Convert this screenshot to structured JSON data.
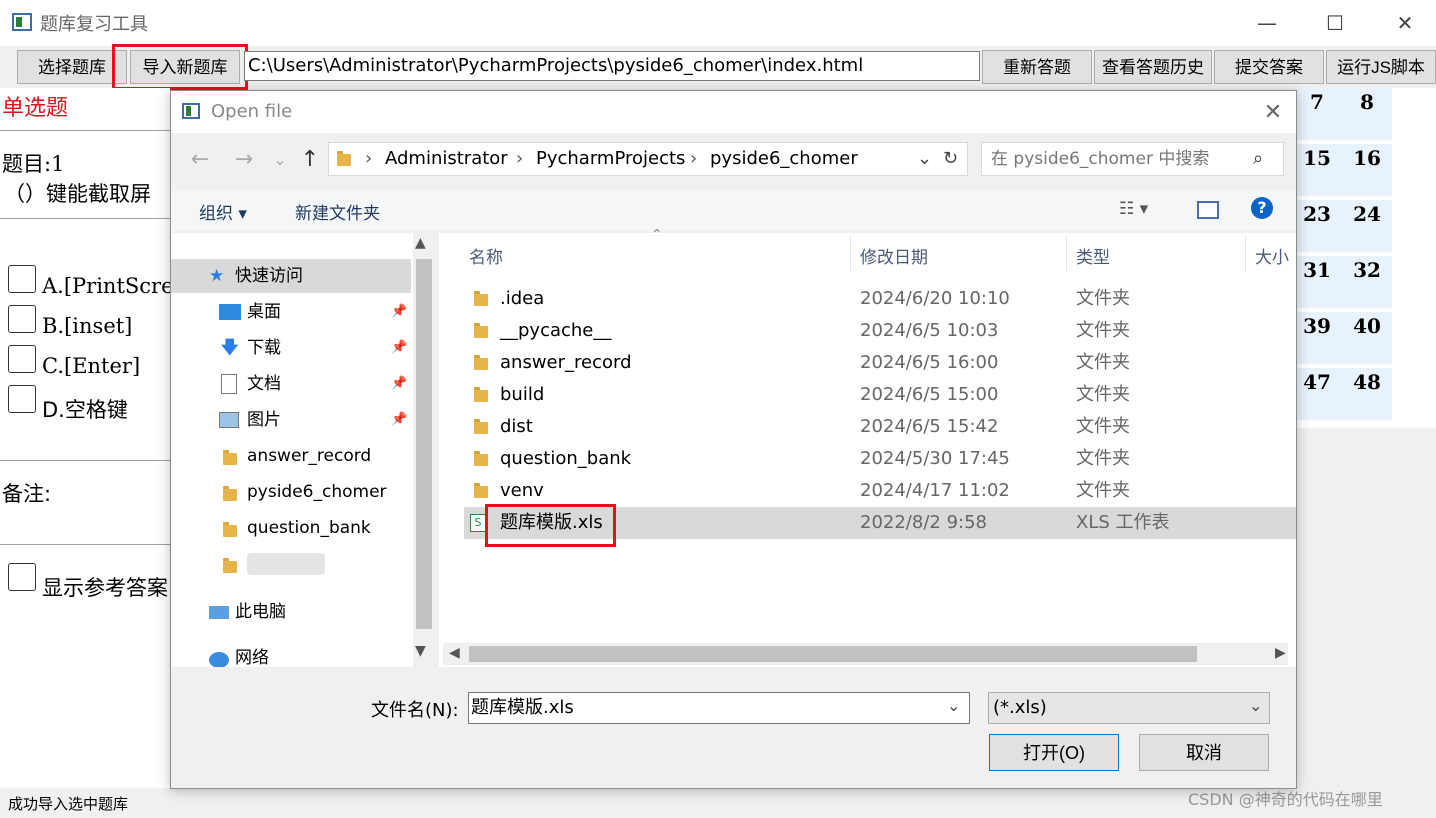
{
  "window": {
    "title": "题库复习工具",
    "minimize": "—",
    "maximize": "☐",
    "close": "✕"
  },
  "toolbar": {
    "select_bank": "选择题库",
    "import_bank": "导入新题库",
    "path_value": "C:\\Users\\Administrator\\PycharmProjects\\pyside6_chomer\\index.html",
    "restart": "重新答题",
    "history": "查看答题历史",
    "submit": "提交答案",
    "run_js": "运行JS脚本"
  },
  "question": {
    "type_label": "单选题",
    "number_label": "题目:1",
    "text": "（）键能截取屏",
    "options": [
      "A.[PrintScree",
      "B.[inset]",
      "C.[Enter]",
      "D.空格键"
    ],
    "notes_label": "备注:",
    "show_answer_label": "显示参考答案"
  },
  "number_grid": [
    [
      "7",
      "8"
    ],
    [
      "15",
      "16"
    ],
    [
      "23",
      "24"
    ],
    [
      "31",
      "32"
    ],
    [
      "39",
      "40"
    ],
    [
      "47",
      "48"
    ]
  ],
  "status": "成功导入选中题库",
  "watermark": "CSDN @神奇的代码在哪里",
  "dialog": {
    "title": "Open file",
    "close": "✕",
    "nav": {
      "back": "←",
      "forward": "→",
      "recent": "⌄",
      "up": "↑"
    },
    "breadcrumb": [
      "Administrator",
      "PycharmProjects",
      "pyside6_chomer"
    ],
    "refresh": "↻",
    "search_placeholder": "在 pyside6_chomer 中搜索",
    "organize": "组织 ▾",
    "new_folder": "新建文件夹",
    "help": "?",
    "nav_items": [
      {
        "label": "快速访问",
        "icon": "star-icon"
      },
      {
        "label": "桌面",
        "icon": "desktop-icon"
      },
      {
        "label": "下载",
        "icon": "download-icon"
      },
      {
        "label": "文档",
        "icon": "document-icon"
      },
      {
        "label": "图片",
        "icon": "picture-icon"
      },
      {
        "label": "answer_record",
        "icon": "folder-icon"
      },
      {
        "label": "pyside6_chomer",
        "icon": "folder-icon"
      },
      {
        "label": "question_bank",
        "icon": "folder-icon"
      },
      {
        "label": "",
        "icon": "folder-icon"
      },
      {
        "label": "此电脑",
        "icon": "computer-icon"
      },
      {
        "label": "网络",
        "icon": "network-icon"
      }
    ],
    "columns": {
      "name": "名称",
      "date": "修改日期",
      "type": "类型",
      "size": "大小"
    },
    "files": [
      {
        "name": ".idea",
        "date": "2024/6/20 10:10",
        "type": "文件夹"
      },
      {
        "name": "__pycache__",
        "date": "2024/6/5 10:03",
        "type": "文件夹"
      },
      {
        "name": "answer_record",
        "date": "2024/6/5 16:00",
        "type": "文件夹"
      },
      {
        "name": "build",
        "date": "2024/6/5 15:00",
        "type": "文件夹"
      },
      {
        "name": "dist",
        "date": "2024/6/5 15:42",
        "type": "文件夹"
      },
      {
        "name": "question_bank",
        "date": "2024/5/30 17:45",
        "type": "文件夹"
      },
      {
        "name": "venv",
        "date": "2024/4/17 11:02",
        "type": "文件夹"
      },
      {
        "name": "题库模版.xls",
        "date": "2022/8/2 9:58",
        "type": "XLS 工作表"
      }
    ],
    "filename_label": "文件名(N):",
    "filename_value": "题库模版.xls",
    "filetype_value": "(*.xls)",
    "open_button": "打开(O)",
    "cancel_button": "取消"
  }
}
